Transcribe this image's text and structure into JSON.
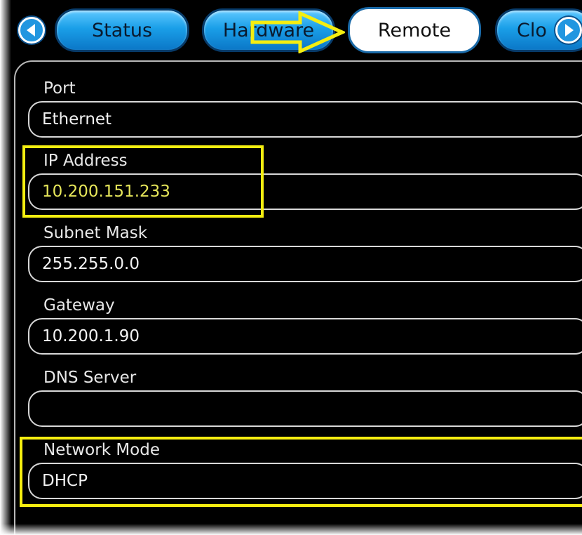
{
  "tabs": {
    "status": "Status",
    "hardware": "Hardware",
    "remote": "Remote",
    "clock_partial": "Clo"
  },
  "fields": {
    "port": {
      "label": "Port",
      "value": "Ethernet"
    },
    "ip_address": {
      "label": "IP Address",
      "value": "10.200.151.233"
    },
    "subnet_mask": {
      "label": "Subnet Mask",
      "value": "255.255.0.0"
    },
    "gateway": {
      "label": "Gateway",
      "value": "10.200.1.90"
    },
    "dns_server": {
      "label": "DNS Server",
      "value": ""
    },
    "network_mode": {
      "label": "Network Mode",
      "value": "DHCP"
    }
  },
  "icons": {
    "prev": "arrow-left-icon",
    "next": "arrow-right-icon",
    "annotation_arrow": "arrow-right-icon"
  },
  "colors": {
    "background": "#000000",
    "tab_blue": "#1a9fe8",
    "highlight": "#f5ee10",
    "ip_text": "#e6e65a"
  }
}
